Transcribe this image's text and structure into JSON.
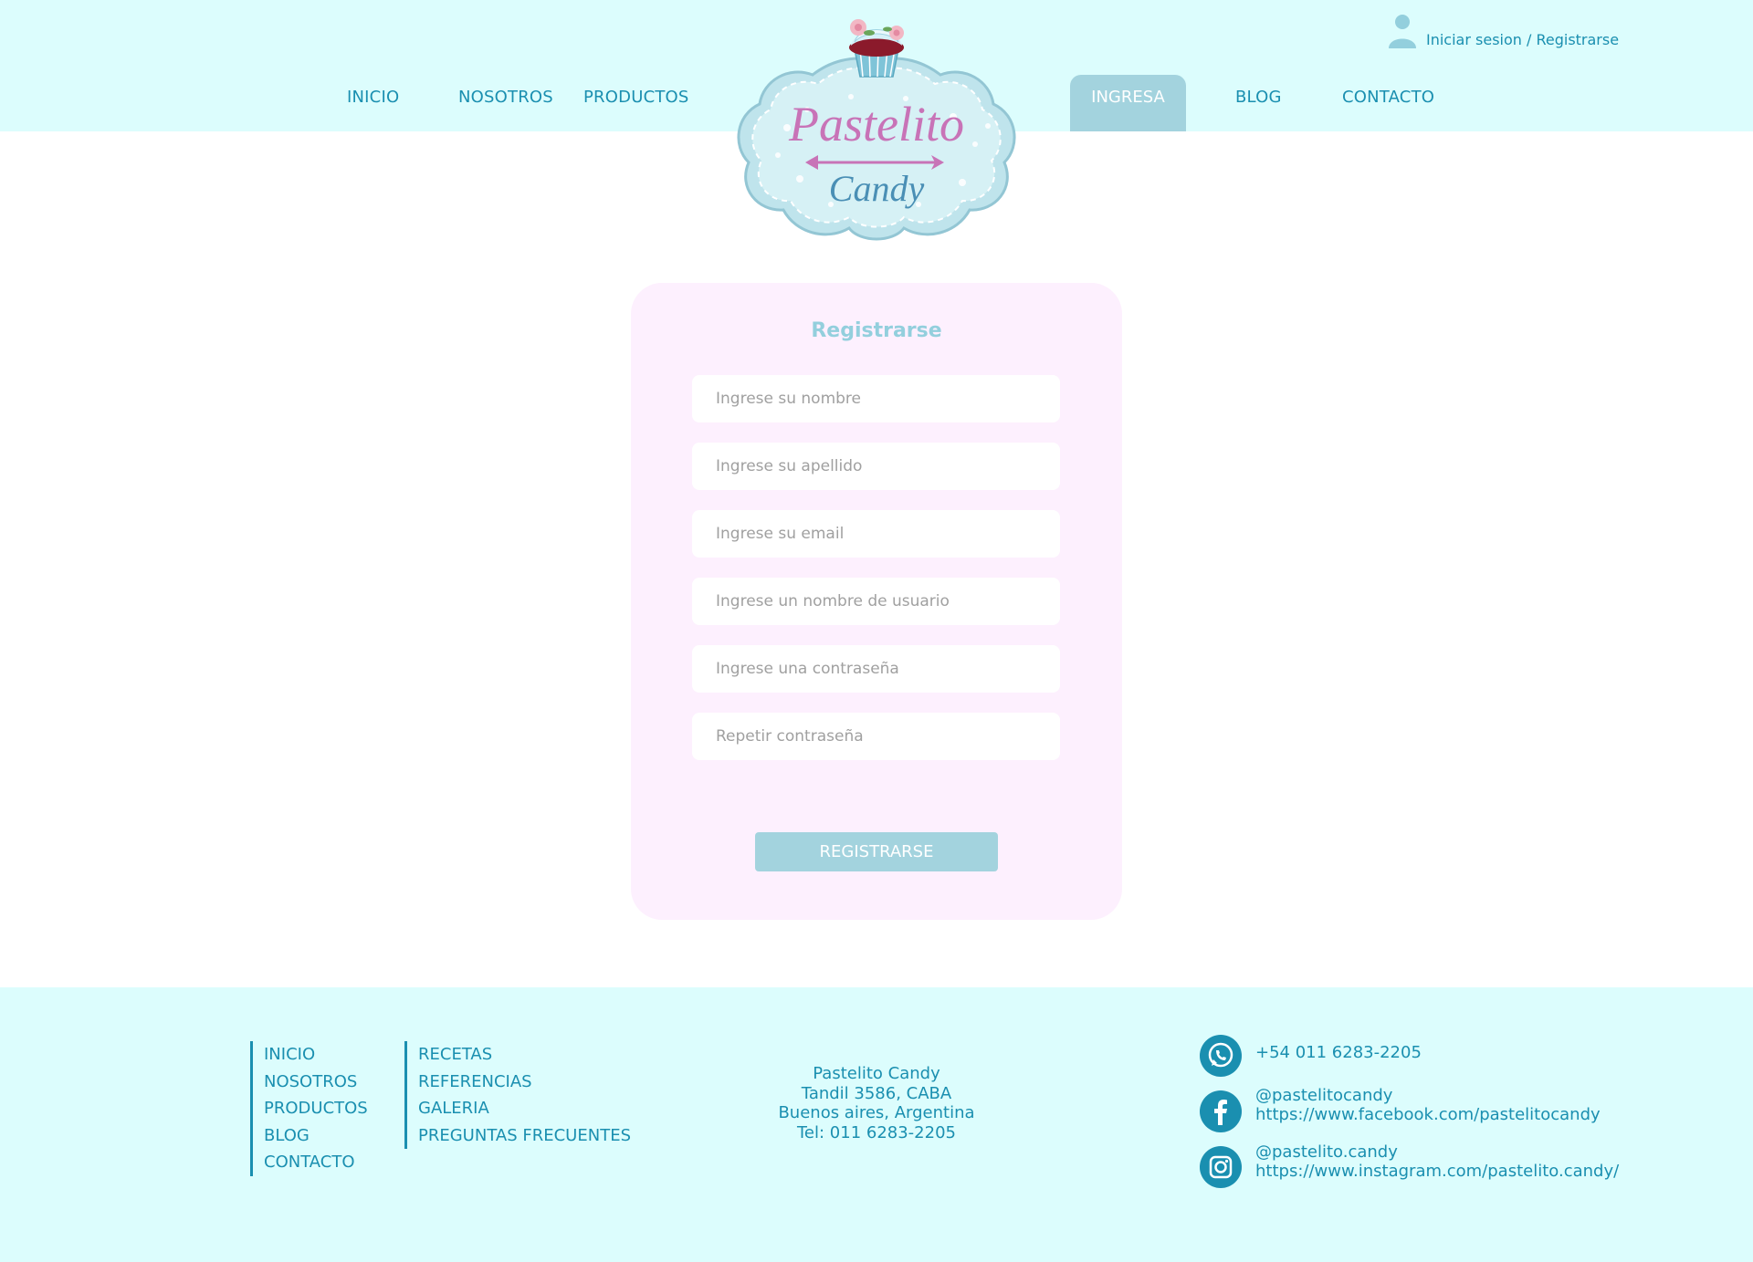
{
  "nav": {
    "left": [
      "INICIO",
      "NOSOTROS",
      "PRODUCTOS"
    ],
    "active": "INGRESA",
    "right": [
      "BLOG",
      "CONTACTO"
    ]
  },
  "user": {
    "label": "Iniciar sesion / Registrarse",
    "icon": "user-icon"
  },
  "logo": {
    "word1": "Pastelito",
    "word2": "Candy"
  },
  "form": {
    "title": "Registrarse",
    "fields": [
      {
        "placeholder": "Ingrese su nombre"
      },
      {
        "placeholder": "Ingrese su apellido"
      },
      {
        "placeholder": "Ingrese su email"
      },
      {
        "placeholder": "Ingrese un nombre de usuario"
      },
      {
        "placeholder": "Ingrese una contraseña"
      },
      {
        "placeholder": "Repetir contraseña"
      }
    ],
    "submit_label": "REGISTRARSE"
  },
  "footer": {
    "col1": [
      "INICIO",
      "NOSOTROS",
      "PRODUCTOS",
      "BLOG",
      "CONTACTO"
    ],
    "col2": [
      "RECETAS",
      "REFERENCIAS",
      "GALERIA",
      "PREGUNTAS FRECUENTES"
    ],
    "address": [
      "Pastelito Candy",
      "Tandil 3586, CABA",
      "Buenos aires, Argentina",
      "Tel: 011 6283-2205"
    ],
    "contacts": {
      "whatsapp": {
        "icon": "whatsapp-icon",
        "line1": "+54 011 6283-2205"
      },
      "facebook": {
        "icon": "facebook-icon",
        "line1": "@pastelitocandy",
        "line2": "https://www.facebook.com/pastelitocandy"
      },
      "instagram": {
        "icon": "instagram-icon",
        "line1": "@pastelito.candy",
        "line2": "https://www.instagram.com/pastelito.candy/"
      }
    }
  },
  "colors": {
    "header_bg": "#dcfdfd",
    "link": "#1a8fb0",
    "accent": "#a3d3de",
    "card_bg": "#fdf0fe",
    "logo_pink": "#c873b7"
  }
}
